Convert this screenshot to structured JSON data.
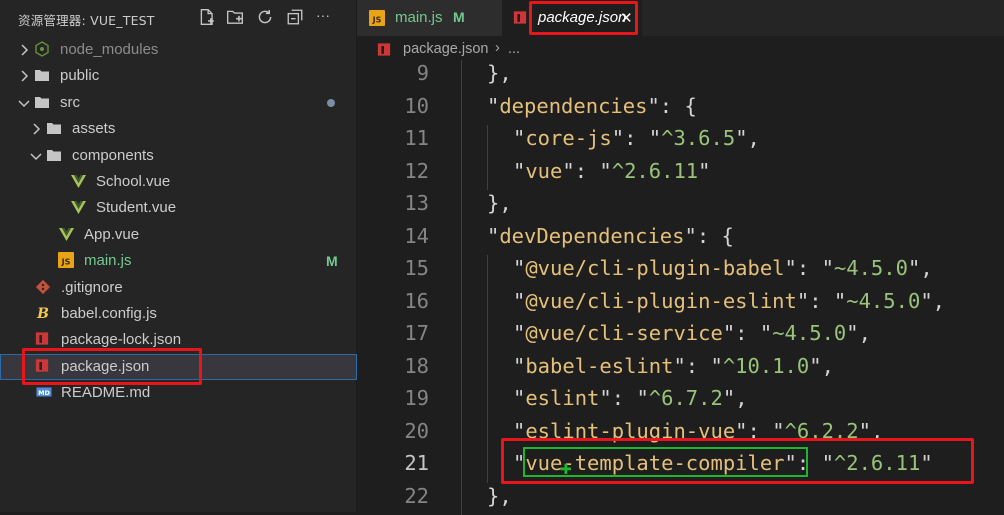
{
  "sidebar": {
    "title": "资源管理器: VUE_TEST",
    "actions": [
      "new-file-icon",
      "new-folder-icon",
      "refresh-icon",
      "collapse-all-icon",
      "more-icon"
    ],
    "more_label": "···",
    "items": [
      {
        "label": "node_modules",
        "depth": 0,
        "type": "folder",
        "expanded": false,
        "icon": "node-modules-icon",
        "dim": true
      },
      {
        "label": "public",
        "depth": 0,
        "type": "folder",
        "expanded": false,
        "icon": "folder-icon"
      },
      {
        "label": "src",
        "depth": 0,
        "type": "folder",
        "expanded": true,
        "icon": "folder-icon",
        "dot": true
      },
      {
        "label": "assets",
        "depth": 1,
        "type": "folder",
        "expanded": false,
        "icon": "folder-icon"
      },
      {
        "label": "components",
        "depth": 1,
        "type": "folder",
        "expanded": true,
        "icon": "folder-icon"
      },
      {
        "label": "School.vue",
        "depth": 2,
        "type": "file",
        "icon": "vue-icon"
      },
      {
        "label": "Student.vue",
        "depth": 2,
        "type": "file",
        "icon": "vue-icon"
      },
      {
        "label": "App.vue",
        "depth": 1,
        "type": "file",
        "icon": "vue-icon"
      },
      {
        "label": "main.js",
        "depth": 1,
        "type": "file",
        "icon": "js-icon",
        "badge": "M",
        "modified": true
      },
      {
        "label": ".gitignore",
        "depth": 0,
        "type": "file",
        "icon": "git-icon"
      },
      {
        "label": "babel.config.js",
        "depth": 0,
        "type": "file",
        "icon": "babel-icon"
      },
      {
        "label": "package-lock.json",
        "depth": 0,
        "type": "file",
        "icon": "npm-icon"
      },
      {
        "label": "package.json",
        "depth": 0,
        "type": "file",
        "icon": "npm-icon",
        "selected": true
      },
      {
        "label": "README.md",
        "depth": 0,
        "type": "file",
        "icon": "markdown-icon"
      }
    ]
  },
  "tabs": [
    {
      "label": "main.js",
      "icon": "js-icon",
      "badge": "M",
      "active": false
    },
    {
      "label": "package.json",
      "icon": "npm-icon",
      "close": "✕",
      "active": true
    }
  ],
  "breadcrumb": {
    "file": "package.json",
    "separator": "›",
    "more": "..."
  },
  "editor": {
    "current_line": 21,
    "lines": [
      {
        "num": "9",
        "depth": 1,
        "tokens": [
          [
            "punc",
            "},"
          ]
        ]
      },
      {
        "num": "10",
        "depth": 1,
        "tokens": [
          [
            "quote",
            "\""
          ],
          [
            "key",
            "dependencies"
          ],
          [
            "quote",
            "\""
          ],
          [
            "punc",
            ": {"
          ]
        ]
      },
      {
        "num": "11",
        "depth": 2,
        "tokens": [
          [
            "quote",
            "\""
          ],
          [
            "key",
            "core-js"
          ],
          [
            "quote",
            "\""
          ],
          [
            "punc",
            ": "
          ],
          [
            "quote",
            "\""
          ],
          [
            "str",
            "^3.6.5"
          ],
          [
            "quote",
            "\""
          ],
          [
            "punc",
            ","
          ]
        ]
      },
      {
        "num": "12",
        "depth": 2,
        "tokens": [
          [
            "quote",
            "\""
          ],
          [
            "key",
            "vue"
          ],
          [
            "quote",
            "\""
          ],
          [
            "punc",
            ": "
          ],
          [
            "quote",
            "\""
          ],
          [
            "str",
            "^2.6.11"
          ],
          [
            "quote",
            "\""
          ]
        ]
      },
      {
        "num": "13",
        "depth": 1,
        "tokens": [
          [
            "punc",
            "},"
          ]
        ]
      },
      {
        "num": "14",
        "depth": 1,
        "tokens": [
          [
            "quote",
            "\""
          ],
          [
            "key",
            "devDependencies"
          ],
          [
            "quote",
            "\""
          ],
          [
            "punc",
            ": {"
          ]
        ]
      },
      {
        "num": "15",
        "depth": 2,
        "tokens": [
          [
            "quote",
            "\""
          ],
          [
            "key",
            "@vue/cli-plugin-babel"
          ],
          [
            "quote",
            "\""
          ],
          [
            "punc",
            ": "
          ],
          [
            "quote",
            "\""
          ],
          [
            "str",
            "~4.5.0"
          ],
          [
            "quote",
            "\""
          ],
          [
            "punc",
            ","
          ]
        ]
      },
      {
        "num": "16",
        "depth": 2,
        "tokens": [
          [
            "quote",
            "\""
          ],
          [
            "key",
            "@vue/cli-plugin-eslint"
          ],
          [
            "quote",
            "\""
          ],
          [
            "punc",
            ": "
          ],
          [
            "quote",
            "\""
          ],
          [
            "str",
            "~4.5.0"
          ],
          [
            "quote",
            "\""
          ],
          [
            "punc",
            ","
          ]
        ]
      },
      {
        "num": "17",
        "depth": 2,
        "tokens": [
          [
            "quote",
            "\""
          ],
          [
            "key",
            "@vue/cli-service"
          ],
          [
            "quote",
            "\""
          ],
          [
            "punc",
            ": "
          ],
          [
            "quote",
            "\""
          ],
          [
            "str",
            "~4.5.0"
          ],
          [
            "quote",
            "\""
          ],
          [
            "punc",
            ","
          ]
        ]
      },
      {
        "num": "18",
        "depth": 2,
        "tokens": [
          [
            "quote",
            "\""
          ],
          [
            "key",
            "babel-eslint"
          ],
          [
            "quote",
            "\""
          ],
          [
            "punc",
            ": "
          ],
          [
            "quote",
            "\""
          ],
          [
            "str",
            "^10.1.0"
          ],
          [
            "quote",
            "\""
          ],
          [
            "punc",
            ","
          ]
        ]
      },
      {
        "num": "19",
        "depth": 2,
        "tokens": [
          [
            "quote",
            "\""
          ],
          [
            "key",
            "eslint"
          ],
          [
            "quote",
            "\""
          ],
          [
            "punc",
            ": "
          ],
          [
            "quote",
            "\""
          ],
          [
            "str",
            "^6.7.2"
          ],
          [
            "quote",
            "\""
          ],
          [
            "punc",
            ","
          ]
        ]
      },
      {
        "num": "20",
        "depth": 2,
        "tokens": [
          [
            "quote",
            "\""
          ],
          [
            "key",
            "eslint-plugin-vue"
          ],
          [
            "quote",
            "\""
          ],
          [
            "punc",
            ": "
          ],
          [
            "quote",
            "\""
          ],
          [
            "str",
            "^6.2.2"
          ],
          [
            "quote",
            "\""
          ],
          [
            "punc",
            ","
          ]
        ]
      },
      {
        "num": "21",
        "depth": 2,
        "tokens": [
          [
            "quote",
            "\""
          ],
          [
            "key",
            "vue-template-compiler"
          ],
          [
            "quote",
            "\""
          ],
          [
            "punc",
            ": "
          ],
          [
            "quote",
            "\""
          ],
          [
            "str",
            "^2.6.11"
          ],
          [
            "quote",
            "\""
          ]
        ]
      },
      {
        "num": "22",
        "depth": 1,
        "tokens": [
          [
            "punc",
            "},"
          ]
        ]
      }
    ]
  },
  "colors": {
    "highlight_red": "#e8161b",
    "highlight_green": "#1fb52c",
    "modified": "#73c991",
    "json_key": "#e5c07b",
    "json_string": "#98c379"
  }
}
